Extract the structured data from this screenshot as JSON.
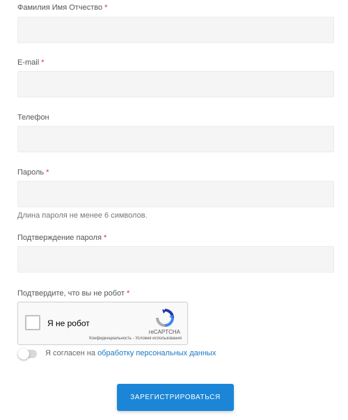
{
  "form": {
    "fullname": {
      "label": "Фамилия Имя Отчество",
      "required_mark": "*",
      "value": "",
      "placeholder": ""
    },
    "email": {
      "label": "E-mail",
      "required_mark": "*",
      "value": "",
      "placeholder": ""
    },
    "phone": {
      "label": "Телефон",
      "value": "",
      "placeholder": ""
    },
    "password": {
      "label": "Пароль",
      "required_mark": "*",
      "value": "",
      "placeholder": "",
      "hint": "Длина пароля не менее 6 символов."
    },
    "password_confirm": {
      "label": "Подтверждение пароля",
      "required_mark": "*",
      "value": "",
      "placeholder": ""
    },
    "captcha": {
      "label": "Подтвердите, что вы не робот",
      "required_mark": "*",
      "checkbox_label": "Я не робот",
      "brand": "reCAPTCHA",
      "privacy_link": "Конфиденциальность",
      "separator": " - ",
      "terms_link": "Условия использования"
    },
    "consent": {
      "text": "Я согласен на",
      "link": "обработку персональных данных",
      "checked": false
    },
    "submit_label": "ЗАРЕГИСТРИРОВАТЬСЯ"
  },
  "colors": {
    "required": "#e02b2b",
    "link": "#1a77c2",
    "button": "#1b86d7",
    "field_bg": "#f5f5f5"
  },
  "icons": {
    "captcha_logo": "recaptcha-logo-icon"
  }
}
